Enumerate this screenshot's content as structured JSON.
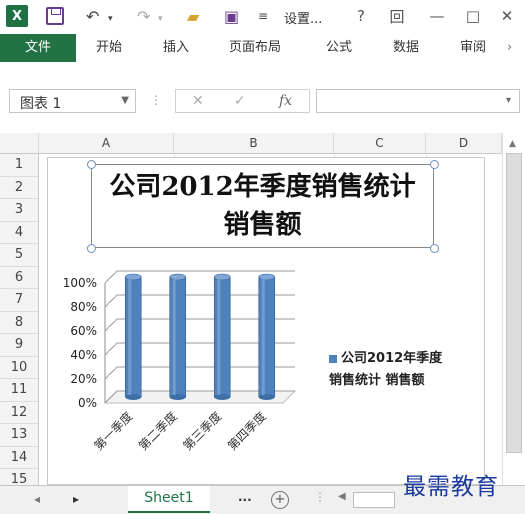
{
  "titlebar": {
    "app_icon": "X",
    "title": "设置...",
    "help": "?",
    "restore": "回",
    "minimize": "—",
    "maximize": "□",
    "close": "✕"
  },
  "ribbon": {
    "tabs": [
      "文件",
      "开始",
      "插入",
      "页面布局",
      "公式",
      "数据",
      "审阅"
    ]
  },
  "formula_bar": {
    "name_box": "图表 1",
    "cancel": "✕",
    "enter": "✓",
    "fx": "fx",
    "formula": ""
  },
  "grid": {
    "columns": [
      "A",
      "B",
      "C",
      "D"
    ],
    "rows": [
      "1",
      "2",
      "3",
      "4",
      "5",
      "6",
      "7",
      "8",
      "9",
      "10",
      "11",
      "12",
      "13",
      "14",
      "15"
    ]
  },
  "chart_data": {
    "type": "bar",
    "title": "公司2012年季度销售统计\n销售额",
    "title_lines": [
      "公司2012年季度销售统计",
      "销售额"
    ],
    "categories": [
      "第一季度",
      "第二季度",
      "第三季度",
      "第四季度"
    ],
    "series": [
      {
        "name": "公司2012年季度销售统计 销售额",
        "values": [
          100,
          100,
          100,
          100
        ]
      }
    ],
    "legend_lines": [
      "公司2012年季度",
      "销售统计 销售额"
    ],
    "y_ticks": [
      "0%",
      "20%",
      "40%",
      "60%",
      "80%",
      "100%"
    ],
    "ylim": [
      0,
      100
    ],
    "legend_position": "right",
    "grid": true,
    "colors": {
      "bar": "#4f81bd"
    }
  },
  "sheet_tabs": {
    "active": "Sheet1",
    "more": "...",
    "add": "+"
  },
  "watermark": "最需教育"
}
